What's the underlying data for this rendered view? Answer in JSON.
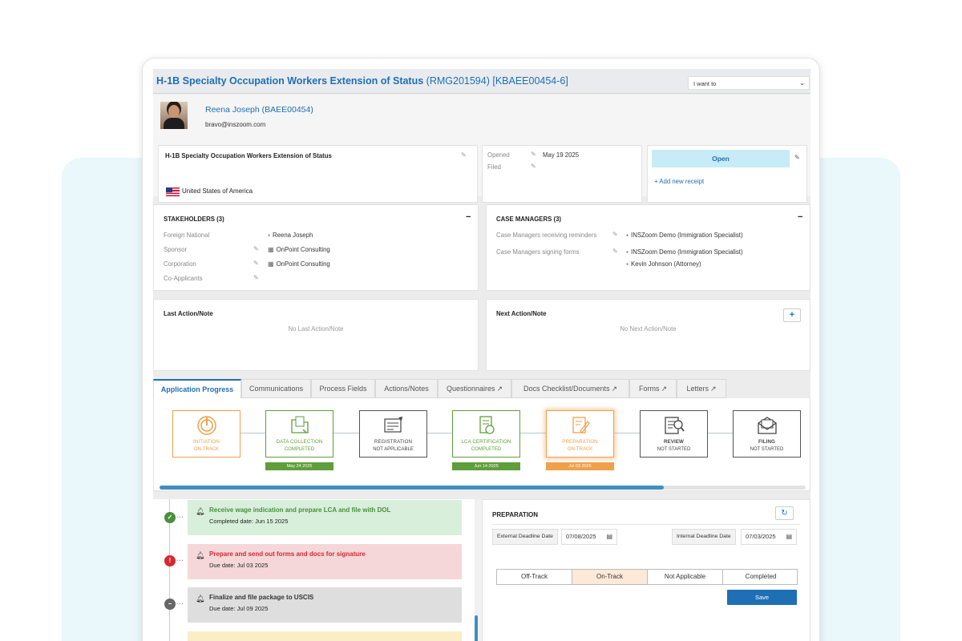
{
  "case": {
    "title": "H-1B Specialty Occupation Workers Extension of Status",
    "ids": "(RMG201594) [KBAEE00454-6]",
    "iwant_label": "I want to"
  },
  "person": {
    "name": "Reena Joseph (BAEE00454)",
    "email": "bravo@inszoom.com"
  },
  "summary": {
    "case_type": "H-1B Specialty Occupation Workers Extension of Status",
    "country": "United States of America",
    "opened_label": "Opened",
    "opened_value": "May 19 2025",
    "filed_label": "Filed",
    "status_button": "Open",
    "add_receipt": "+ Add new receipt"
  },
  "stakeholders": {
    "heading": "STAKEHOLDERS (3)",
    "collapse": "−",
    "rows": [
      {
        "label": "Foreign National",
        "value": "Reena Joseph"
      },
      {
        "label": "Sponsor",
        "value": "OnPoint Consulting"
      },
      {
        "label": "Corporation",
        "value": "OnPoint Consulting"
      },
      {
        "label": "Co-Applicants",
        "value": ""
      }
    ]
  },
  "case_managers": {
    "heading": "CASE MANAGERS (3)",
    "collapse": "−",
    "reminders_label": "Case Managers receiving reminders",
    "reminders_value": "INSZoom Demo (Immigration Specialist)",
    "signing_label": "Case Managers signing forms",
    "signing_values": [
      "INSZoom Demo (Immigration Specialist)",
      "Kevin Johnson (Attorney)"
    ]
  },
  "notes": {
    "last_heading": "Last Action/Note",
    "last_empty": "No Last Action/Note",
    "next_heading": "Next Action/Note",
    "next_empty": "No Next Action/Note",
    "add": "+"
  },
  "tabs": [
    {
      "label": "Application Progress"
    },
    {
      "label": "Communications"
    },
    {
      "label": "Process Fields"
    },
    {
      "label": "Actions/Notes"
    },
    {
      "label": "Questionnaires"
    },
    {
      "label": "Docs Checklist/Documents"
    },
    {
      "label": "Forms"
    },
    {
      "label": "Letters"
    }
  ],
  "stages": [
    {
      "name": "INITIATION",
      "status": "ON-TRACK",
      "date": "",
      "icon": "power-icon",
      "color": "#f0a04b"
    },
    {
      "name": "DATA COLLECTION",
      "status": "COMPLETED",
      "date": "May 24 2025",
      "icon": "folder-icon",
      "color": "#5f9e3a"
    },
    {
      "name": "REGISTRATION",
      "status": "NOT APPLICABLE",
      "date": "",
      "icon": "keyboard-icon",
      "color": "#444444"
    },
    {
      "name": "LCA CERTIFICATION",
      "status": "COMPLETED",
      "date": "Jun 14 2025",
      "icon": "certificate-icon",
      "color": "#5f9e3a"
    },
    {
      "name": "PREPARATION",
      "status": "ON-TRACK",
      "date": "Jul 03 2025",
      "icon": "document-pen-icon",
      "color": "#f0a04b"
    },
    {
      "name": "REVIEW",
      "status": "NOT STARTED",
      "date": "",
      "icon": "checklist-icon",
      "color": "#444444"
    },
    {
      "name": "FILING",
      "status": "NOT STARTED",
      "date": "",
      "icon": "envelope-icon",
      "color": "#444444"
    }
  ],
  "progress": {
    "fraction": 0.78
  },
  "tasks": [
    {
      "title": "Receive wage indication and prepare LCA and file with DOL",
      "date": "Completed date: Jun 15 2025",
      "state": "completed"
    },
    {
      "title": "Prepare and send out forms and docs for signature",
      "date": "Due date: Jul 03 2025",
      "state": "overdue"
    },
    {
      "title": "Finalize and file package to USCIS",
      "date": "Due date: Jul 09 2025",
      "state": "pending"
    }
  ],
  "preparation": {
    "heading": "PREPARATION",
    "ext_label": "External Deadline Date",
    "ext_value": "07/08/2025",
    "int_label": "Internal Deadline Date",
    "int_value": "07/03/2025",
    "options": [
      "Off-Track",
      "On-Track",
      "Not Applicable",
      "Completed"
    ],
    "selected": "On-Track",
    "save": "Save"
  }
}
